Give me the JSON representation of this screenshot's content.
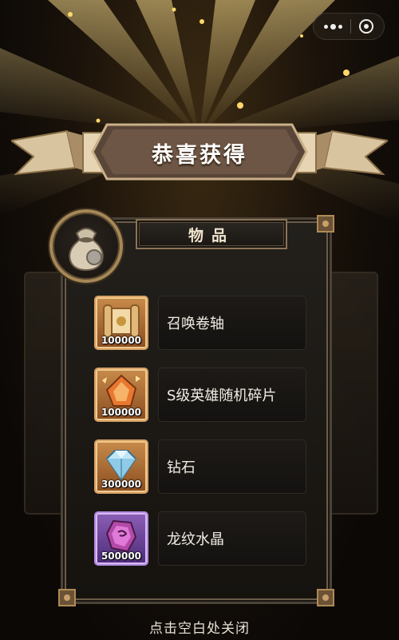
{
  "header": {
    "title": "恭喜获得"
  },
  "section": {
    "label": "物品"
  },
  "items": [
    {
      "name": "召唤卷轴",
      "quantity": "100000",
      "icon": "scroll-icon",
      "rarity": "orange"
    },
    {
      "name": "S级英雄随机碎片",
      "quantity": "100000",
      "icon": "hero-shard-icon",
      "rarity": "orange"
    },
    {
      "name": "钻石",
      "quantity": "300000",
      "icon": "diamond-icon",
      "rarity": "orange"
    },
    {
      "name": "龙纹水晶",
      "quantity": "500000",
      "icon": "dragon-crystal-icon",
      "rarity": "purple"
    }
  ],
  "footer": {
    "hint": "点击空白处关闭"
  },
  "colors": {
    "accent_gold": "#b08a55",
    "rarity_orange": "#c88b4a",
    "rarity_purple": "#8b5fb6"
  }
}
